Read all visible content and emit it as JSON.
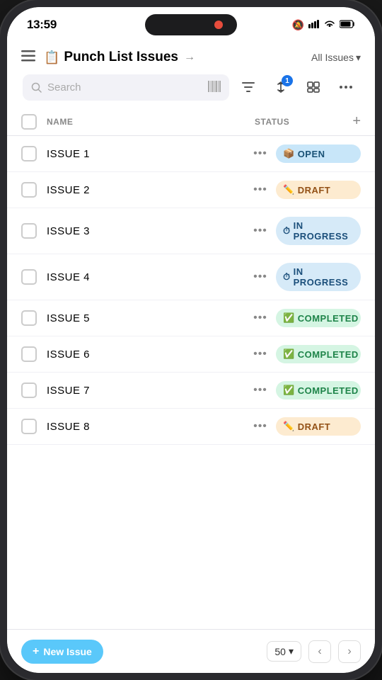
{
  "status_bar": {
    "time": "13:59",
    "mute_icon": "🔕",
    "signal_icon": "📶",
    "wifi_icon": "📡",
    "battery_icon": "🔋"
  },
  "header": {
    "menu_icon": "☰",
    "title_emoji": "📋",
    "title": "Punch List Issues",
    "arrow": "→",
    "filter_label": "All Issues",
    "filter_chevron": "▾"
  },
  "toolbar": {
    "search_placeholder": "Search",
    "filter_icon": "⊟",
    "sort_icon": "↕",
    "sort_badge": "1",
    "group_icon": "⊞",
    "more_icon": "•••"
  },
  "table": {
    "headers": {
      "name": "NAME",
      "status": "STATUS",
      "add": "+"
    },
    "rows": [
      {
        "id": 1,
        "name": "Issue 1",
        "status": "Open",
        "status_type": "open",
        "emoji": "📦"
      },
      {
        "id": 2,
        "name": "Issue 2",
        "status": "Draft",
        "status_type": "draft",
        "emoji": "✏️"
      },
      {
        "id": 3,
        "name": "Issue 3",
        "status": "In Progress",
        "status_type": "inprogress",
        "emoji": "⏱"
      },
      {
        "id": 4,
        "name": "Issue 4",
        "status": "In Progress",
        "status_type": "inprogress",
        "emoji": "⏱"
      },
      {
        "id": 5,
        "name": "Issue 5",
        "status": "Completed",
        "status_type": "completed",
        "emoji": "✅"
      },
      {
        "id": 6,
        "name": "Issue 6",
        "status": "Completed",
        "status_type": "completed",
        "emoji": "✅"
      },
      {
        "id": 7,
        "name": "Issue 7",
        "status": "Completed",
        "status_type": "completed",
        "emoji": "✅"
      },
      {
        "id": 8,
        "name": "Issue 8",
        "status": "Draft",
        "status_type": "draft",
        "emoji": "✏️"
      }
    ]
  },
  "footer": {
    "new_issue_plus": "+",
    "new_issue_label": "New Issue",
    "page_size": "50",
    "page_size_chevron": "▾",
    "prev_nav": "‹",
    "next_nav": "›"
  }
}
